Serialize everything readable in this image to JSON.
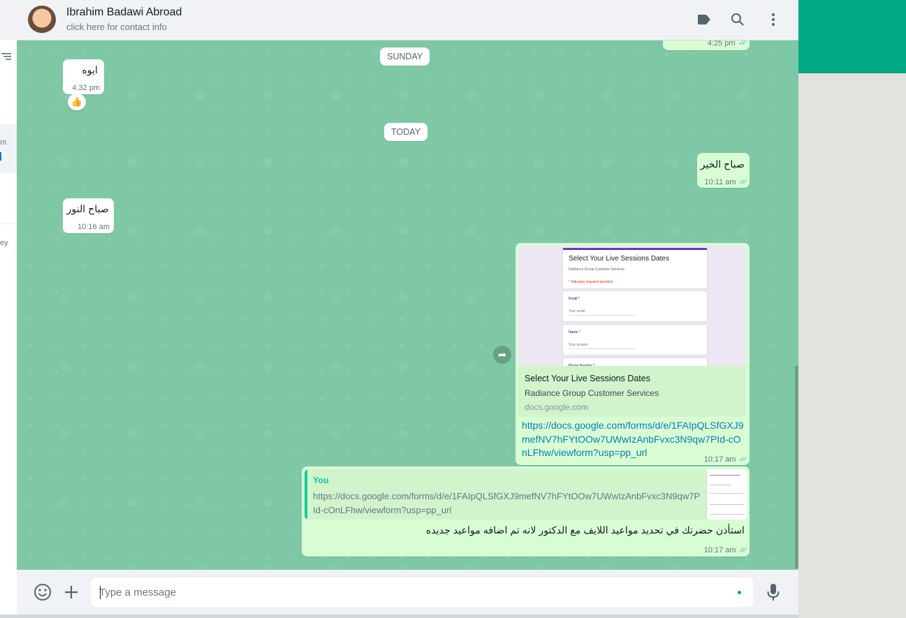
{
  "colors": {
    "accent": "#00a884",
    "incoming_bubble": "#ffffff",
    "outgoing_bubble": "#d9fdd3",
    "link": "#027eb5",
    "read_ticks": "#53bdeb",
    "chat_background": "#7fc8a6"
  },
  "sidebar": {
    "fragment_1": "m",
    "fragment_2": "ey"
  },
  "header": {
    "contact_name": "Ibrahim Badawi Abroad",
    "contact_subtitle": "click here for contact info",
    "icons": [
      "label-icon",
      "search-icon",
      "menu-icon"
    ]
  },
  "chat": {
    "top_partial_time": "4:25 pm",
    "sunday_label": "SUNDAY",
    "today_label": "TODAY",
    "msg_aywa": {
      "text": "ايوه",
      "time": "4:32 pm",
      "reaction": "👍"
    },
    "msg_sabah_alkhair": {
      "text": "صباح الخير",
      "time": "10:11 am"
    },
    "msg_sabah_alnoor": {
      "text": "صباح النور",
      "time": "10:16 am"
    },
    "link_message": {
      "preview_form_title": "Select Your Live Sessions Dates",
      "preview_form_subtitle": "Radiance Group Customer Services",
      "preview_required_note": "* Indicates required question",
      "preview_email_label": "Email *",
      "preview_email_hint": "Your email",
      "preview_name_label": "Name *",
      "preview_name_hint": "Your answer",
      "preview_phone_label": "Phone Number *",
      "preview_title": "Select Your Live Sessions Dates",
      "preview_description": "Radiance Group Customer Services",
      "preview_domain": "docs.google.com",
      "url": "https://docs.google.com/forms/d/e/1FAIpQLSfGXJ9mefNV7hFYtOOw7UWwIzAnbFvxc3N9qw7PId-cOnLFhw/viewform?usp=pp_url",
      "time": "10:17 am"
    },
    "reply_message": {
      "quoted_author": "You",
      "quoted_text": "https://docs.google.com/forms/d/e/1FAIpQLSfGXJ9mefNV7hFYtOOw7UWwIzAnbFvxc3N9qw7PId-cOnLFhw/viewform?usp=pp_url",
      "text": "استأذن حضرتك في تحديد مواعيد اللايف مع الدكتور لانه تم اضافه مواعيد جديده",
      "time": "10:17 am"
    }
  },
  "composer": {
    "placeholder": "Type a message",
    "icons": [
      "emoji-icon",
      "attach-plus-icon",
      "microphone-icon"
    ]
  }
}
